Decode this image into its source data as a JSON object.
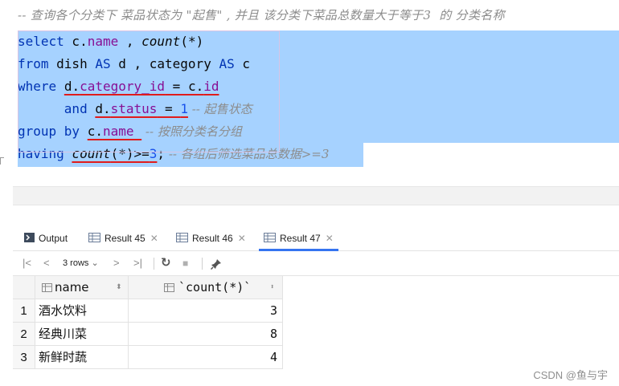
{
  "editor": {
    "comment": "-- 查询各个分类下 菜品状态为 \"起售\" , 并且 该分类下菜品总数量大于等于3  的 分类名称",
    "lines": {
      "l1": {
        "kw": "select",
        "rest1": " c.",
        "field": "name",
        "rest2": " , ",
        "fn": "count",
        "rest3": "(*)"
      },
      "l2": {
        "kw1": "from",
        "rest1": " dish ",
        "kw2": "AS",
        "rest2": " d , category ",
        "kw3": "AS",
        "rest3": " c"
      },
      "l3": {
        "kw": "where",
        "sp": " ",
        "a": "d.",
        "fa": "category_id",
        "eq": " = c.",
        "fb": "id"
      },
      "l4": {
        "indent": "      ",
        "kw": "and",
        "sp": " ",
        "a": "d.",
        "fa": "status",
        "eq": " = ",
        "num": "1",
        "cmt": " -- 起售状态"
      },
      "l5": {
        "kw": "group by",
        "sp": " ",
        "a": "c.",
        "fa": "name",
        "sp2": " ",
        "cmt": " -- 按照分类名分组"
      },
      "l6": {
        "kw": "having",
        "sp": " ",
        "fn": "count",
        "rest": "(*)>=",
        "num": "3",
        "semi": ";",
        "cmt": " -- 各组后筛选菜品总数据>=3"
      }
    }
  },
  "tabs": [
    {
      "label": "Output",
      "icon": "console-icon"
    },
    {
      "label": "Result 45",
      "icon": "grid-icon"
    },
    {
      "label": "Result 46",
      "icon": "grid-icon"
    },
    {
      "label": "Result 47",
      "icon": "grid-icon",
      "active": true
    }
  ],
  "toolbar": {
    "first": "|<",
    "prev": "<",
    "rows": "3 rows",
    "rows_caret": "⌄",
    "next": ">",
    "last": ">|",
    "refresh": "↻",
    "stop": "■",
    "pin": "📌"
  },
  "table": {
    "columns": [
      "name",
      "`count(*)`"
    ],
    "rows": [
      {
        "idx": "1",
        "name": "酒水饮料",
        "count": "3"
      },
      {
        "idx": "2",
        "name": "经典川菜",
        "count": "8"
      },
      {
        "idx": "3",
        "name": "新鲜时蔬",
        "count": "4"
      }
    ]
  },
  "watermark": "CSDN @鱼与宇",
  "colors": {
    "selection": "#a6d2ff",
    "keyword": "#0033b3",
    "field": "#871094",
    "number": "#1750eb",
    "underline": "#e01b1b",
    "active_tab": "#3574f0"
  }
}
